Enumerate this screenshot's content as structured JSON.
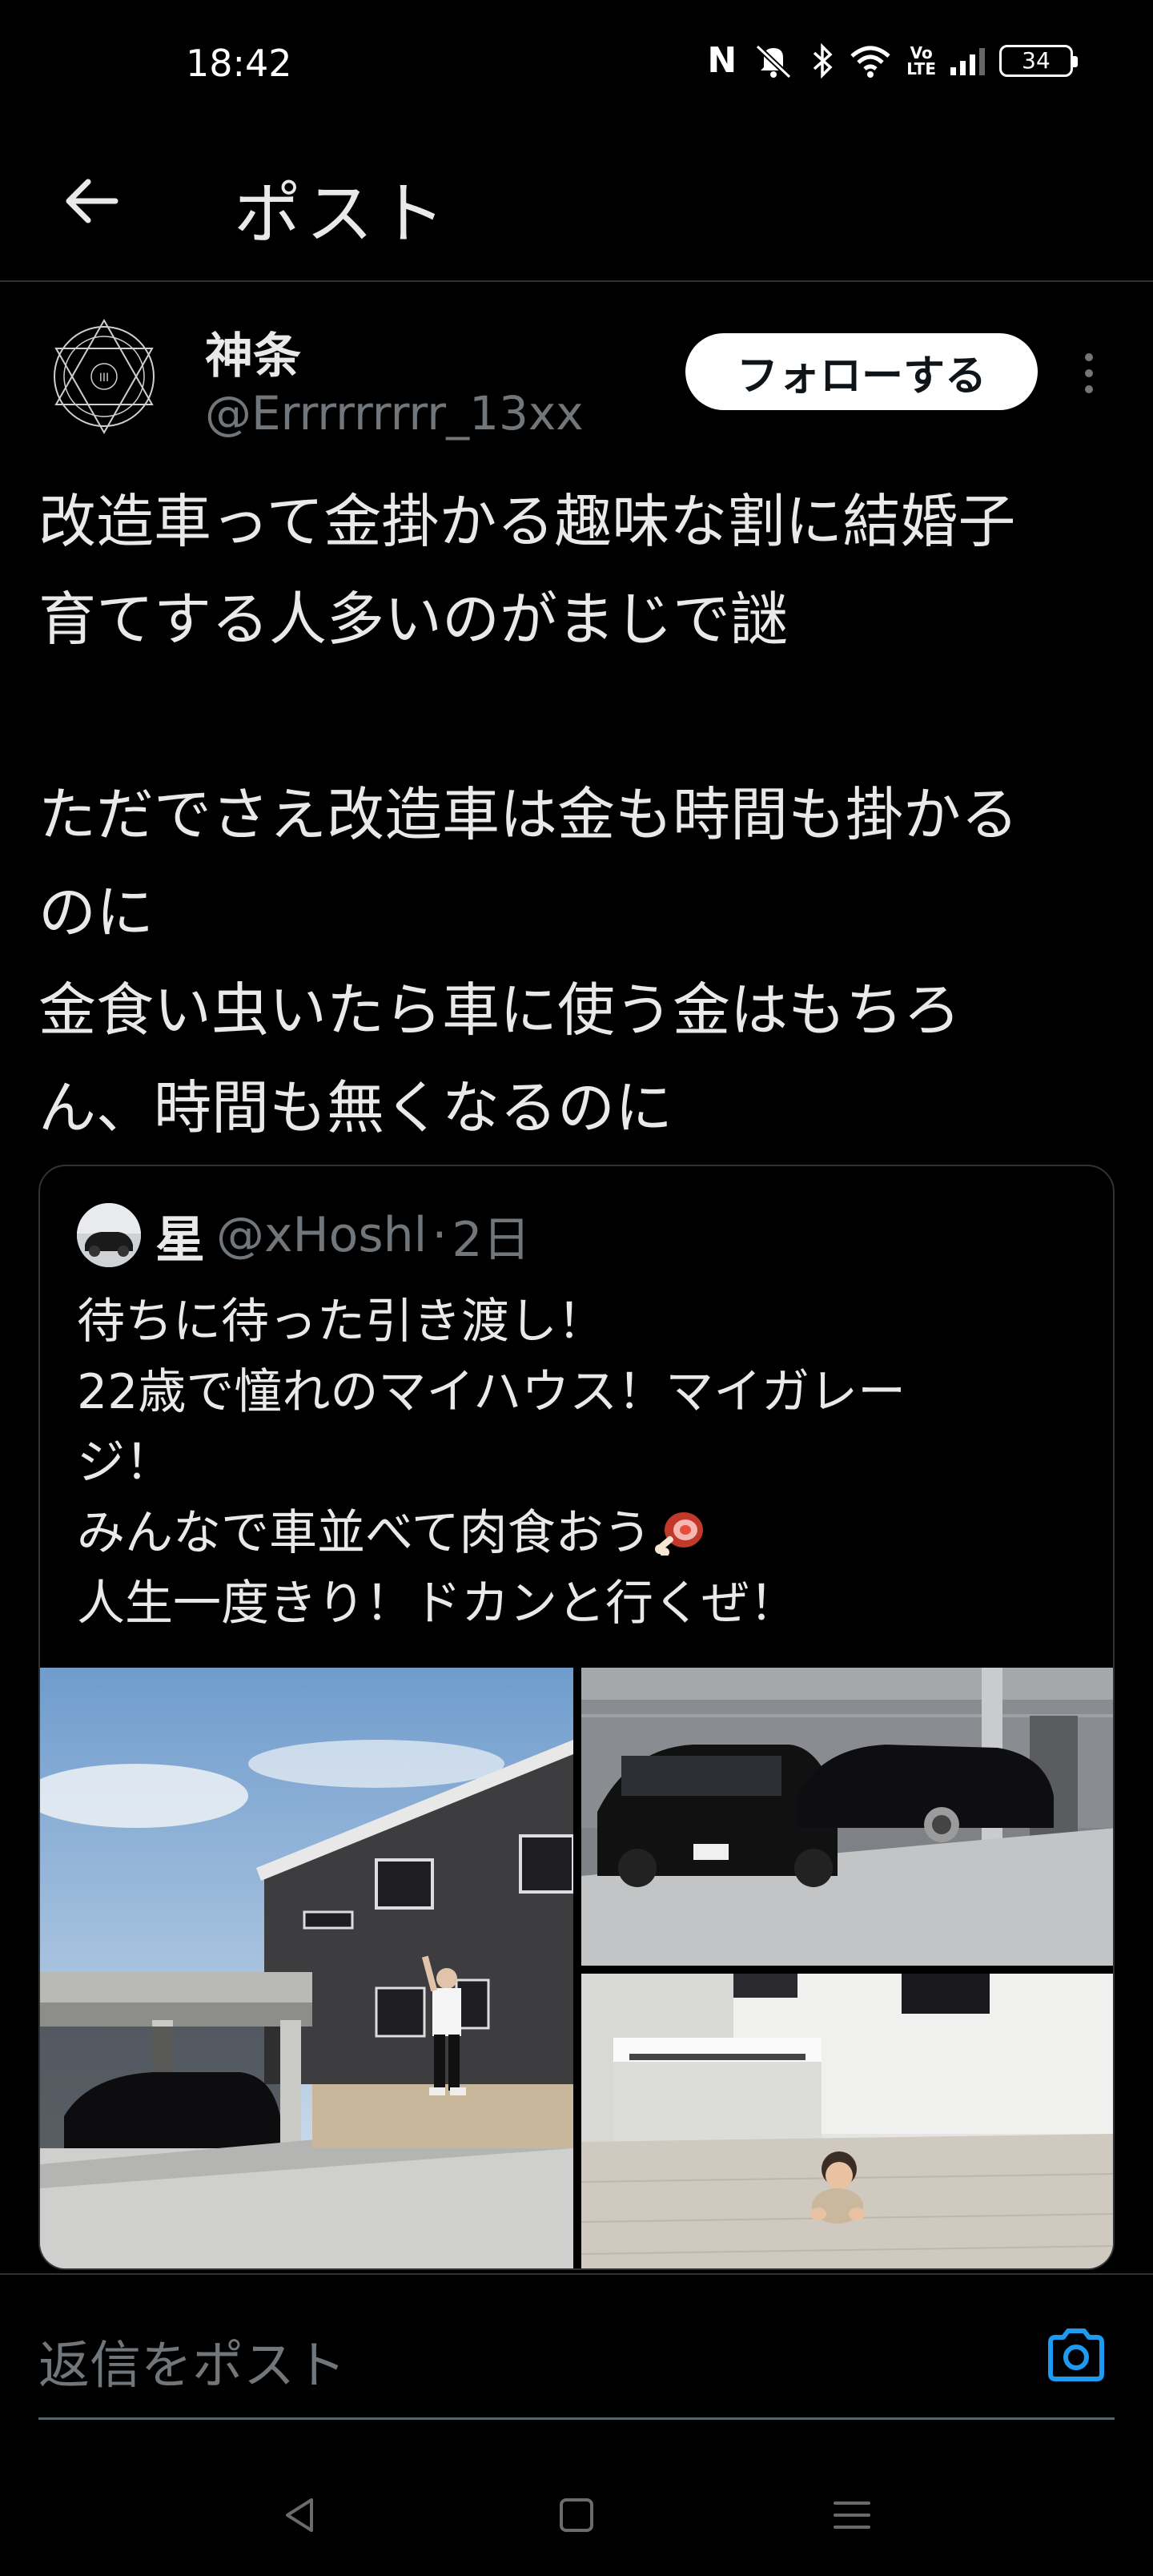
{
  "status_bar": {
    "time": "18:42",
    "battery": "34",
    "volte": "Vo\nLTE",
    "icons": [
      "nfc-icon",
      "mute-icon",
      "bluetooth-icon",
      "wifi-icon",
      "volte-icon",
      "signal-icon",
      "battery-icon"
    ]
  },
  "header": {
    "title": "ポスト",
    "back_icon": "arrow-left-icon"
  },
  "tweet": {
    "author_name": "神条",
    "author_handle": "@Errrrrrrrr_13xx",
    "follow_label": "フォローする",
    "text": "改造車って金掛かる趣味な割に結婚子\n育てする人多いのがまじで謎\n\nただでさえ改造車は金も時間も掛かる\nのに\n金食い虫いたら車に使う金はもちろ\nん、時間も無くなるのに"
  },
  "quote": {
    "author_name": "星",
    "author_handle": "@xHoshl",
    "separator": "·",
    "time": "2日",
    "text": "待ちに待った引き渡し！\n22歳で憧れのマイハウス！マイガレー\nジ！\nみんなで車並べて肉食おう",
    "text_after_emoji": "\n人生一度きり！ドカンと行くぜ！",
    "emoji": "meat-on-bone-icon",
    "media": [
      "house-with-garage-photo",
      "cars-in-garage-photo",
      "baby-on-floor-photo"
    ]
  },
  "reply": {
    "placeholder": "返信をポスト",
    "icon": "camera-icon"
  },
  "nav": {
    "icons": [
      "back-triangle-icon",
      "home-square-icon",
      "menu-lines-icon"
    ]
  },
  "colors": {
    "background": "#000000",
    "text": "#e7e9ea",
    "secondary": "#71767b",
    "border": "#2f3336",
    "accent": "#1d9bf0"
  }
}
